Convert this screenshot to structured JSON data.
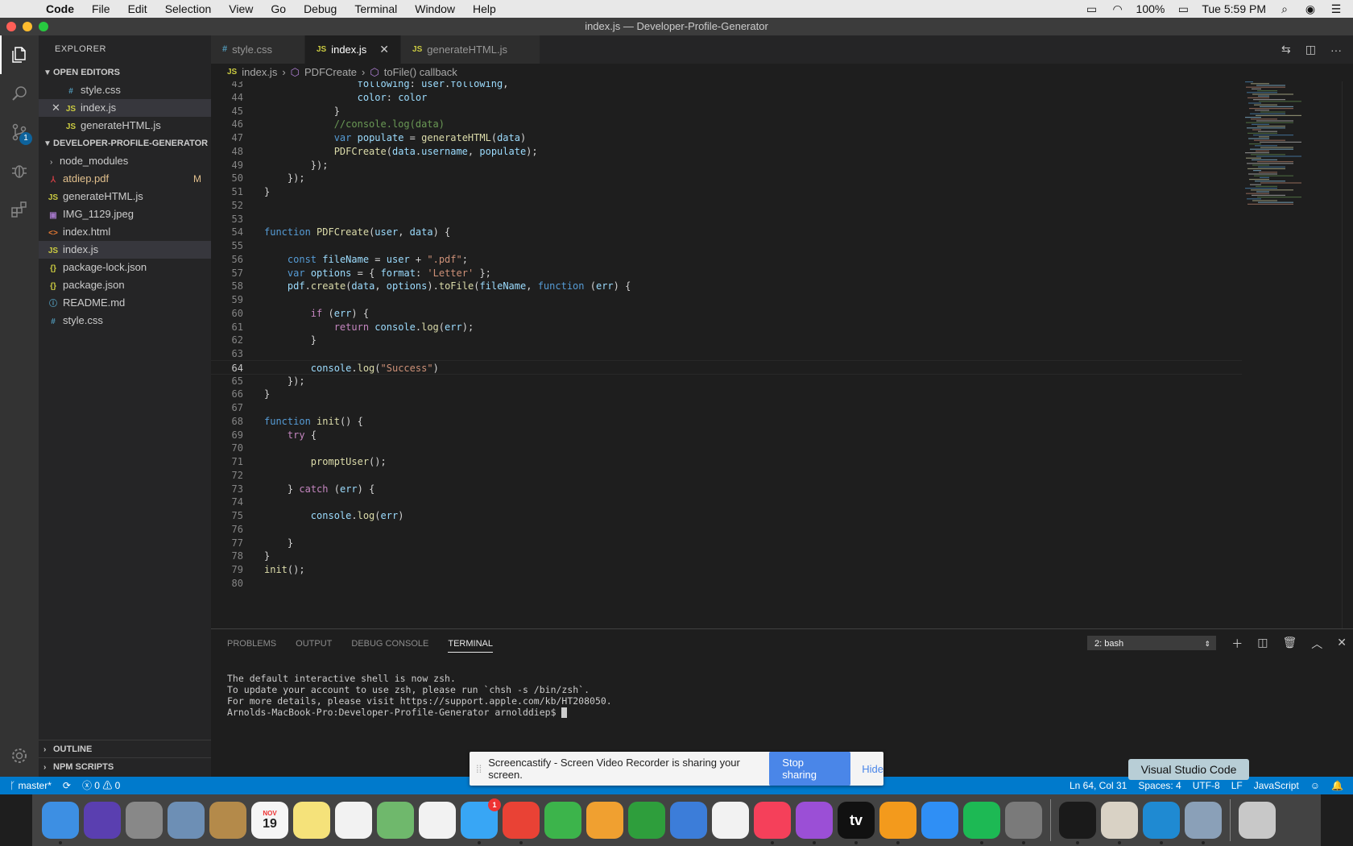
{
  "menubar": {
    "app_name": "Code",
    "items": [
      "File",
      "Edit",
      "Selection",
      "View",
      "Go",
      "Debug",
      "Terminal",
      "Window",
      "Help"
    ],
    "battery": "100%",
    "clock": "Tue 5:59 PM"
  },
  "window": {
    "title": "index.js — Developer-Profile-Generator"
  },
  "activity": {
    "scm_badge": "1"
  },
  "sidebar": {
    "title": "EXPLORER",
    "open_editors_label": "OPEN EDITORS",
    "open_editors": [
      {
        "name": "style.css",
        "icon": "#"
      },
      {
        "name": "index.js",
        "icon": "JS"
      },
      {
        "name": "generateHTML.js",
        "icon": "JS"
      }
    ],
    "project_label": "DEVELOPER-PROFILE-GENERATOR",
    "files": [
      {
        "name": "node_modules",
        "icon": ""
      },
      {
        "name": "atdiep.pdf",
        "icon": "⅄",
        "badge": "M"
      },
      {
        "name": "generateHTML.js",
        "icon": "JS"
      },
      {
        "name": "IMG_1129.jpeg",
        "icon": "▣"
      },
      {
        "name": "index.html",
        "icon": "<>"
      },
      {
        "name": "index.js",
        "icon": "JS"
      },
      {
        "name": "package-lock.json",
        "icon": "{}"
      },
      {
        "name": "package.json",
        "icon": "{}"
      },
      {
        "name": "README.md",
        "icon": "ⓘ"
      },
      {
        "name": "style.css",
        "icon": "#"
      }
    ],
    "outline_label": "OUTLINE",
    "npm_label": "NPM SCRIPTS"
  },
  "tabs": [
    {
      "label": "style.css",
      "icon": "#"
    },
    {
      "label": "index.js",
      "icon": "JS"
    },
    {
      "label": "generateHTML.js",
      "icon": "JS"
    }
  ],
  "breadcrumb": {
    "file_icon": "JS",
    "file": "index.js",
    "sep": "›",
    "symbol1": "PDFCreate",
    "symbol2": "toFile() callback"
  },
  "code": [
    {
      "n": "43",
      "t": "                following: user.following,"
    },
    {
      "n": "44",
      "t": "                color: color"
    },
    {
      "n": "45",
      "t": "            }"
    },
    {
      "n": "46",
      "t": "            //console.log(data)"
    },
    {
      "n": "47",
      "t": "            var populate = generateHTML(data)"
    },
    {
      "n": "48",
      "t": "            PDFCreate(data.username, populate);"
    },
    {
      "n": "49",
      "t": "        });"
    },
    {
      "n": "50",
      "t": "    });"
    },
    {
      "n": "51",
      "t": "}"
    },
    {
      "n": "52",
      "t": ""
    },
    {
      "n": "53",
      "t": ""
    },
    {
      "n": "54",
      "t": "function PDFCreate(user, data) {"
    },
    {
      "n": "55",
      "t": ""
    },
    {
      "n": "56",
      "t": "    const fileName = user + \".pdf\";"
    },
    {
      "n": "57",
      "t": "    var options = { format: 'Letter' };"
    },
    {
      "n": "58",
      "t": "    pdf.create(data, options).toFile(fileName, function (err) {"
    },
    {
      "n": "59",
      "t": ""
    },
    {
      "n": "60",
      "t": "        if (err) {"
    },
    {
      "n": "61",
      "t": "            return console.log(err);"
    },
    {
      "n": "62",
      "t": "        }"
    },
    {
      "n": "63",
      "t": ""
    },
    {
      "n": "64",
      "t": "        console.log(\"Success\")"
    },
    {
      "n": "65",
      "t": "    });"
    },
    {
      "n": "66",
      "t": "}"
    },
    {
      "n": "67",
      "t": ""
    },
    {
      "n": "68",
      "t": "function init() {"
    },
    {
      "n": "69",
      "t": "    try {"
    },
    {
      "n": "70",
      "t": ""
    },
    {
      "n": "71",
      "t": "        promptUser();"
    },
    {
      "n": "72",
      "t": ""
    },
    {
      "n": "73",
      "t": "    } catch (err) {"
    },
    {
      "n": "74",
      "t": ""
    },
    {
      "n": "75",
      "t": "        console.log(err)"
    },
    {
      "n": "76",
      "t": ""
    },
    {
      "n": "77",
      "t": "    }"
    },
    {
      "n": "78",
      "t": "}"
    },
    {
      "n": "79",
      "t": "init();"
    },
    {
      "n": "80",
      "t": ""
    }
  ],
  "panel": {
    "tabs": [
      "PROBLEMS",
      "OUTPUT",
      "DEBUG CONSOLE",
      "TERMINAL"
    ],
    "terminal_select": "2: bash",
    "terminal_lines": [
      "The default interactive shell is now zsh.",
      "To update your account to use zsh, please run `chsh -s /bin/zsh`.",
      "For more details, please visit https://support.apple.com/kb/HT208050.",
      "Arnolds-MacBook-Pro:Developer-Profile-Generator arnolddiep$ "
    ]
  },
  "statusbar": {
    "branch": "master*",
    "errors": "0",
    "warnings": "0",
    "position": "Ln 64, Col 31",
    "spaces": "Spaces: 4",
    "encoding": "UTF-8",
    "eol": "LF",
    "language": "JavaScript"
  },
  "notification": {
    "message": "Screencastify - Screen Video Recorder is sharing your screen.",
    "stop_label": "Stop sharing",
    "hide_label": "Hide"
  },
  "tooltip": "Visual Studio Code",
  "dock": {
    "calendar_month": "NOV",
    "calendar_day": "19",
    "messages_badge": "1",
    "tv_label": "tv",
    "apps": [
      {
        "name": "finder",
        "color": "#3d8fe3"
      },
      {
        "name": "siri",
        "color": "#5a3fb0"
      },
      {
        "name": "launchpad",
        "color": "#888888"
      },
      {
        "name": "mail-eagle",
        "color": "#6d8fb5"
      },
      {
        "name": "contacts",
        "color": "#b48a4a"
      },
      {
        "name": "calendar",
        "color": "#f5f5f5"
      },
      {
        "name": "notes",
        "color": "#f5e27a"
      },
      {
        "name": "reminders",
        "color": "#f2f2f2"
      },
      {
        "name": "maps",
        "color": "#6fb86c"
      },
      {
        "name": "photos",
        "color": "#f2f2f2"
      },
      {
        "name": "messages",
        "color": "#38a6f5"
      },
      {
        "name": "chrome",
        "color": "#e94235"
      },
      {
        "name": "facetime",
        "color": "#3cb44b"
      },
      {
        "name": "pages",
        "color": "#f0a030"
      },
      {
        "name": "numbers",
        "color": "#2e9e3c"
      },
      {
        "name": "keynote",
        "color": "#3c7dd9"
      },
      {
        "name": "news",
        "color": "#f2f2f2"
      },
      {
        "name": "music",
        "color": "#f5405a"
      },
      {
        "name": "podcasts",
        "color": "#9b4fd6"
      },
      {
        "name": "apple-tv",
        "color": "#111111"
      },
      {
        "name": "books",
        "color": "#f39a1c"
      },
      {
        "name": "app-store",
        "color": "#2f8ff5"
      },
      {
        "name": "spotify",
        "color": "#1db954"
      },
      {
        "name": "system-preferences",
        "color": "#7a7a7a"
      },
      {
        "name": "terminal",
        "color": "#1a1a1a"
      },
      {
        "name": "textedit",
        "color": "#d9d2c5"
      },
      {
        "name": "vscode",
        "color": "#1f8ad2"
      },
      {
        "name": "preview",
        "color": "#8aa0b8"
      },
      {
        "name": "trash",
        "color": "#c8c8c8"
      }
    ]
  },
  "colors": {
    "accent": "#007acc",
    "editor_bg": "#1e1e1e",
    "sidebar_bg": "#252526"
  }
}
